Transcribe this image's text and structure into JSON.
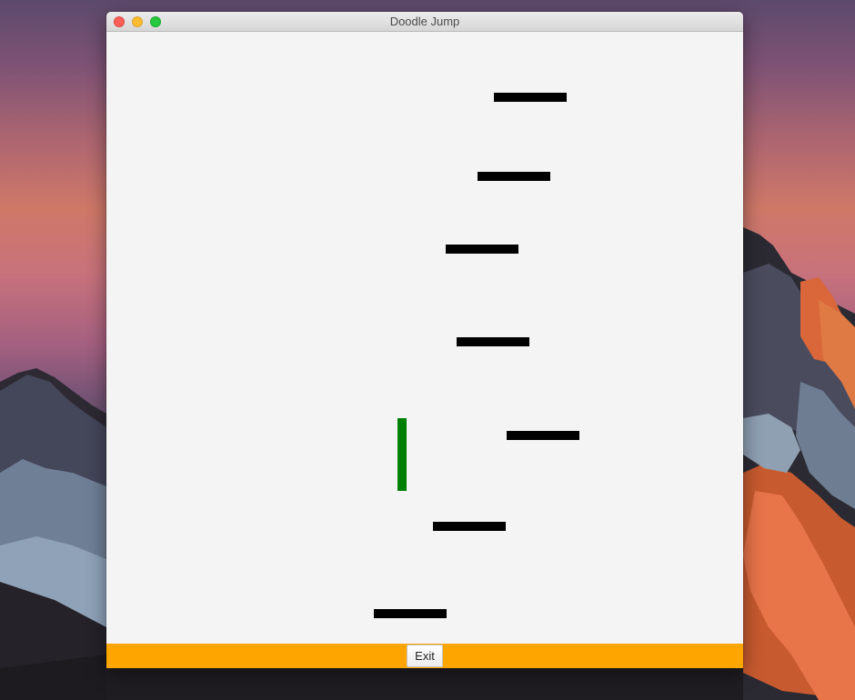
{
  "window": {
    "title": "Doodle Jump"
  },
  "game": {
    "background_color": "#f4f4f4",
    "platform_color": "#000000",
    "doodle_color": "#008000",
    "platform_count": 7
  },
  "footer": {
    "background_color": "#ffa500",
    "exit_label": "Exit"
  }
}
